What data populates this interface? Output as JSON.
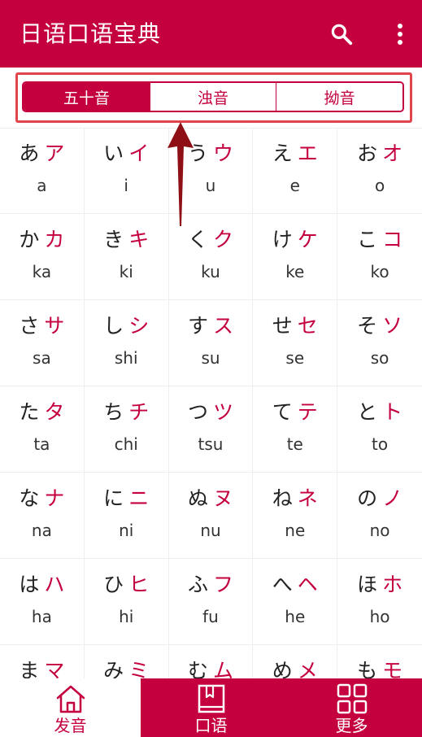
{
  "app": {
    "title": "日语口语宝典",
    "accent_color": "#c4003e"
  },
  "toolbar": {
    "search_icon": "search-icon",
    "more_icon": "more-vertical-icon"
  },
  "tabs": [
    {
      "label": "五十音",
      "active": true
    },
    {
      "label": "浊音",
      "active": false
    },
    {
      "label": "拗音",
      "active": false
    }
  ],
  "kana_rows": [
    [
      {
        "hira": "あ",
        "kata": "ア",
        "roma": "a"
      },
      {
        "hira": "い",
        "kata": "イ",
        "roma": "i"
      },
      {
        "hira": "う",
        "kata": "ウ",
        "roma": "u"
      },
      {
        "hira": "え",
        "kata": "エ",
        "roma": "e"
      },
      {
        "hira": "お",
        "kata": "オ",
        "roma": "o"
      }
    ],
    [
      {
        "hira": "か",
        "kata": "カ",
        "roma": "ka"
      },
      {
        "hira": "き",
        "kata": "キ",
        "roma": "ki"
      },
      {
        "hira": "く",
        "kata": "ク",
        "roma": "ku"
      },
      {
        "hira": "け",
        "kata": "ケ",
        "roma": "ke"
      },
      {
        "hira": "こ",
        "kata": "コ",
        "roma": "ko"
      }
    ],
    [
      {
        "hira": "さ",
        "kata": "サ",
        "roma": "sa"
      },
      {
        "hira": "し",
        "kata": "シ",
        "roma": "shi"
      },
      {
        "hira": "す",
        "kata": "ス",
        "roma": "su"
      },
      {
        "hira": "せ",
        "kata": "セ",
        "roma": "se"
      },
      {
        "hira": "そ",
        "kata": "ソ",
        "roma": "so"
      }
    ],
    [
      {
        "hira": "た",
        "kata": "タ",
        "roma": "ta"
      },
      {
        "hira": "ち",
        "kata": "チ",
        "roma": "chi"
      },
      {
        "hira": "つ",
        "kata": "ツ",
        "roma": "tsu"
      },
      {
        "hira": "て",
        "kata": "テ",
        "roma": "te"
      },
      {
        "hira": "と",
        "kata": "ト",
        "roma": "to"
      }
    ],
    [
      {
        "hira": "な",
        "kata": "ナ",
        "roma": "na"
      },
      {
        "hira": "に",
        "kata": "ニ",
        "roma": "ni"
      },
      {
        "hira": "ぬ",
        "kata": "ヌ",
        "roma": "nu"
      },
      {
        "hira": "ね",
        "kata": "ネ",
        "roma": "ne"
      },
      {
        "hira": "の",
        "kata": "ノ",
        "roma": "no"
      }
    ],
    [
      {
        "hira": "は",
        "kata": "ハ",
        "roma": "ha"
      },
      {
        "hira": "ひ",
        "kata": "ヒ",
        "roma": "hi"
      },
      {
        "hira": "ふ",
        "kata": "フ",
        "roma": "fu"
      },
      {
        "hira": "へ",
        "kata": "ヘ",
        "roma": "he"
      },
      {
        "hira": "ほ",
        "kata": "ホ",
        "roma": "ho"
      }
    ],
    [
      {
        "hira": "ま",
        "kata": "マ",
        "roma": ""
      },
      {
        "hira": "み",
        "kata": "ミ",
        "roma": ""
      },
      {
        "hira": "む",
        "kata": "ム",
        "roma": ""
      },
      {
        "hira": "め",
        "kata": "メ",
        "roma": ""
      },
      {
        "hira": "も",
        "kata": "モ",
        "roma": ""
      }
    ]
  ],
  "bottom_nav": [
    {
      "label": "发音",
      "icon": "home-icon",
      "active": true
    },
    {
      "label": "口语",
      "icon": "book-icon",
      "active": false
    },
    {
      "label": "更多",
      "icon": "grid-icon",
      "active": false
    }
  ]
}
